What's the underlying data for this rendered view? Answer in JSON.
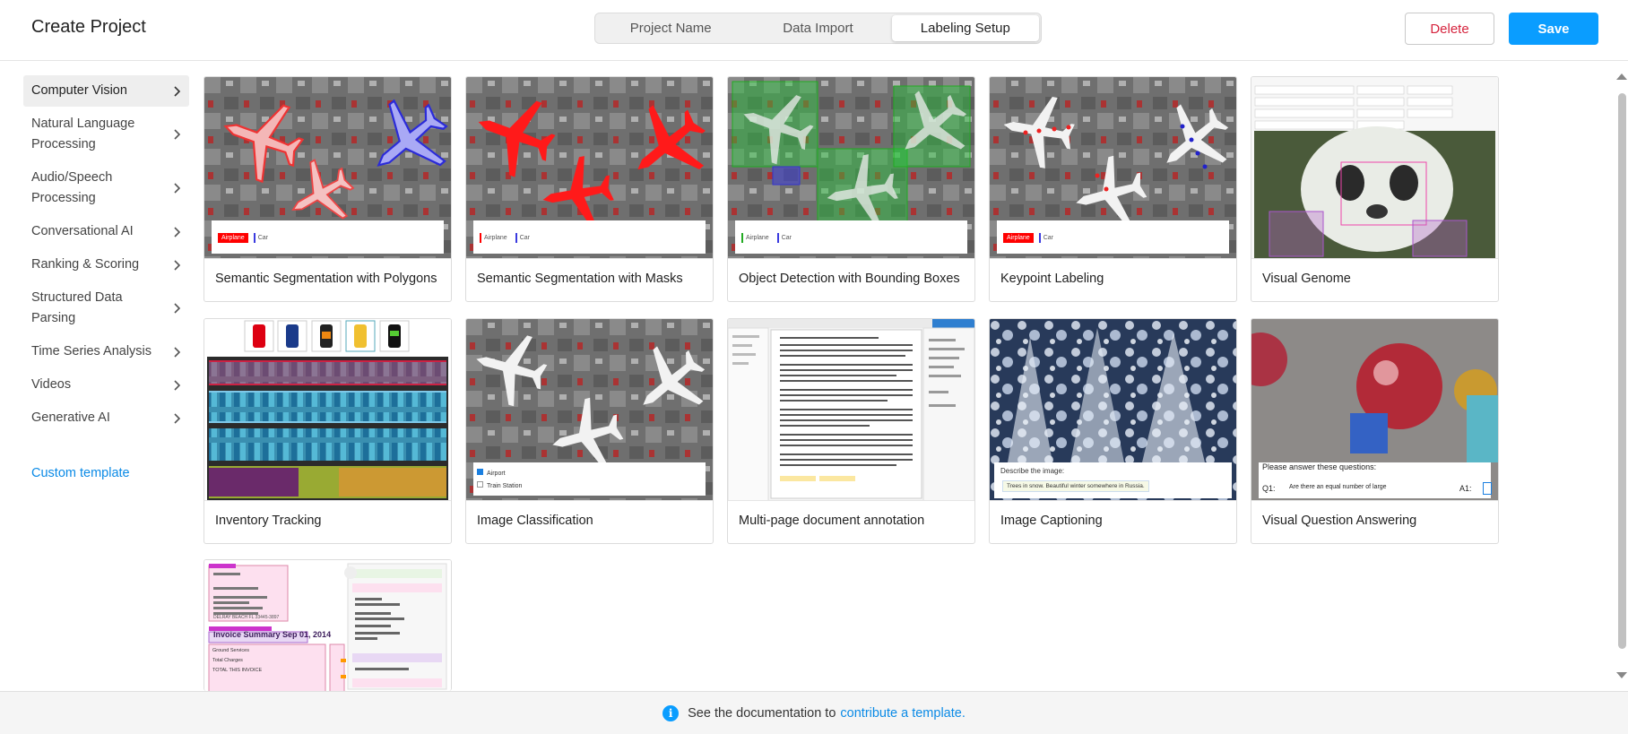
{
  "header": {
    "title": "Create Project",
    "tabs": [
      "Project Name",
      "Data Import",
      "Labeling Setup"
    ],
    "delete_label": "Delete",
    "save_label": "Save"
  },
  "sidebar": {
    "items": [
      {
        "label": "Computer Vision"
      },
      {
        "label": "Natural Language Processing"
      },
      {
        "label": "Audio/Speech Processing"
      },
      {
        "label": "Conversational AI"
      },
      {
        "label": "Ranking & Scoring"
      },
      {
        "label": "Structured Data Parsing"
      },
      {
        "label": "Time Series Analysis"
      },
      {
        "label": "Videos"
      },
      {
        "label": "Generative AI"
      }
    ],
    "custom_template": "Custom template"
  },
  "templates": [
    {
      "label": "Semantic Segmentation with Polygons",
      "tags": [
        "Airplane",
        "Car"
      ]
    },
    {
      "label": "Semantic Segmentation with Masks",
      "tags": [
        "Airplane",
        "Car"
      ]
    },
    {
      "label": "Object Detection with Bounding Boxes",
      "tags": [
        "Airplane",
        "Car"
      ]
    },
    {
      "label": "Keypoint Labeling",
      "tags": [
        "Airplane",
        "Car"
      ]
    },
    {
      "label": "Visual Genome"
    },
    {
      "label": "Inventory Tracking"
    },
    {
      "label": "Image Classification",
      "choices": [
        "Airport",
        "Train Station"
      ]
    },
    {
      "label": "Multi-page document annotation"
    },
    {
      "label": "Image Captioning",
      "prompt": "Describe the image:",
      "caption": "Trees in snow. Beautiful winter somewhere in Russia."
    },
    {
      "label": "Visual Question Answering",
      "prompt": "Please answer these questions:",
      "q_label": "Q1:",
      "a_label": "A1:",
      "question": "Are there an equal number of large"
    },
    {
      "label": "",
      "invoice_title": "Invoice Summary Sep 01, 2014",
      "invoice_lines": [
        "Ground Services",
        "Total Charges",
        "TOTAL THIS INVOICE",
        "DELRAY BEACH FL 33445-3897"
      ]
    }
  ],
  "footer": {
    "text": "See the documentation to",
    "link": "contribute a template."
  },
  "colors": {
    "accent": "#0a9dff",
    "delete": "#d6243e",
    "airplane_tag": "#ff0000",
    "car_tag": "#3a3adf"
  }
}
